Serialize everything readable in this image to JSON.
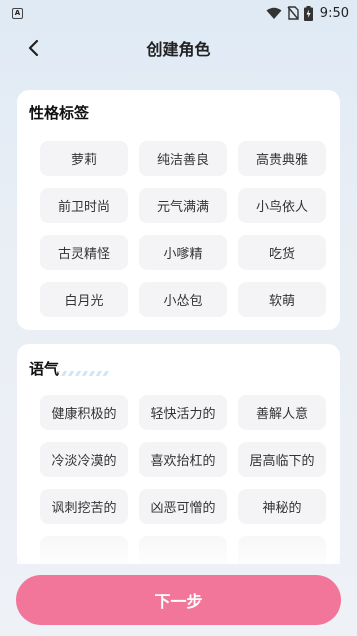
{
  "status_bar": {
    "app_letter": "A",
    "time": "9:50"
  },
  "header": {
    "title": "创建角色",
    "back_icon": "chevron-left-icon"
  },
  "personality": {
    "title": "性格标签",
    "tags": [
      "萝莉",
      "纯洁善良",
      "高贵典雅",
      "前卫时尚",
      "元气满满",
      "小鸟依人",
      "古灵精怪",
      "小嗲精",
      "吃货",
      "白月光",
      "小怂包",
      "软萌"
    ]
  },
  "tone": {
    "title": "语气",
    "tags": [
      "健康积极的",
      "轻快活力的",
      "善解人意",
      "冷淡冷漠的",
      "喜欢抬杠的",
      "居高临下的",
      "讽刺挖苦的",
      "凶恶可憎的",
      "神秘的",
      "",
      "",
      ""
    ]
  },
  "footer": {
    "next_label": "下一步"
  },
  "colors": {
    "accent": "#f2769a",
    "chip_bg": "#f4f4f6"
  }
}
